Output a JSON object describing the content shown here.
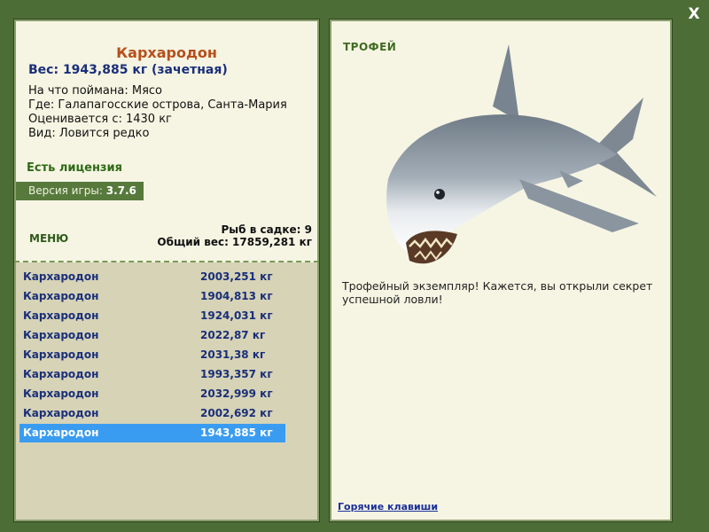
{
  "close_label": "X",
  "fish": {
    "title": "Кархародон",
    "weight_line": "Вес: 1943,885 кг (зачетная)",
    "caught_on": "На что поймана: Мясо",
    "location": "Где: Галапагосские острова, Санта-Мария",
    "valued_from": "Оценивается с: 1430 кг",
    "rarity": "Вид: Ловится редко"
  },
  "license": "Есть лицензия",
  "version": {
    "label": "Версия игры: ",
    "value": "3.7.6"
  },
  "menu_label": "МЕНЮ",
  "stats": {
    "in_net": "Рыб в садке: 9",
    "total_weight": "Общий вес: 17859,281 кг"
  },
  "catch_list": [
    {
      "name": "Кархародон",
      "weight": "2003,251 кг"
    },
    {
      "name": "Кархародон",
      "weight": "1904,813 кг"
    },
    {
      "name": "Кархародон",
      "weight": "1924,031 кг"
    },
    {
      "name": "Кархародон",
      "weight": "2022,87 кг"
    },
    {
      "name": "Кархародон",
      "weight": "2031,38 кг"
    },
    {
      "name": "Кархародон",
      "weight": "1993,357 кг"
    },
    {
      "name": "Кархародон",
      "weight": "2032,999 кг"
    },
    {
      "name": "Кархародон",
      "weight": "2002,692 кг"
    },
    {
      "name": "Кархародон",
      "weight": "1943,885 кг"
    }
  ],
  "selected_index": 8,
  "trophy_label": "ТРОФЕЙ",
  "trophy_description": "Трофейный экземпляр! Кажется, вы открыли секрет успешной ловли!",
  "hotkeys_label": "Горячие клавиши",
  "colors": {
    "frame": "#4d6d37",
    "panel": "#f6f5e3",
    "accent_title": "#b6501c",
    "selection": "#3a9cf0"
  }
}
